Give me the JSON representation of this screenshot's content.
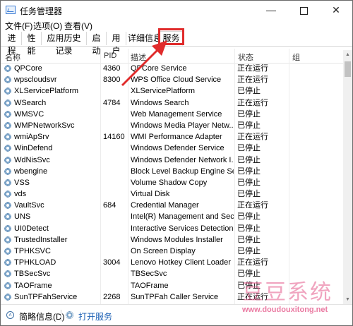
{
  "window": {
    "title": "任务管理器",
    "min_glyph": "—",
    "close_glyph": "✕"
  },
  "menu": [
    "文件(F)",
    "选项(O)",
    "查看(V)"
  ],
  "tabs": [
    "进程",
    "性能",
    "应用历史记录",
    "启动",
    "用户",
    "详细信息",
    "服务"
  ],
  "active_tab": "服务",
  "columns": {
    "name": "名称",
    "pid": "PID",
    "desc": "描述",
    "status": "状态",
    "group": "组"
  },
  "rows": [
    {
      "name": "QPCore",
      "pid": "4360",
      "desc": "QPCore Service",
      "status": "正在运行"
    },
    {
      "name": "wpscloudsvr",
      "pid": "8300",
      "desc": "WPS Office Cloud Service",
      "status": "正在运行"
    },
    {
      "name": "XLServicePlatform",
      "pid": "",
      "desc": "XLServicePlatform",
      "status": "已停止"
    },
    {
      "name": "WSearch",
      "pid": "4784",
      "desc": "Windows Search",
      "status": "正在运行"
    },
    {
      "name": "WMSVC",
      "pid": "",
      "desc": "Web Management Service",
      "status": "已停止"
    },
    {
      "name": "WMPNetworkSvc",
      "pid": "",
      "desc": "Windows Media Player Netw...",
      "status": "已停止"
    },
    {
      "name": "wmiApSrv",
      "pid": "14160",
      "desc": "WMI Performance Adapter",
      "status": "正在运行"
    },
    {
      "name": "WinDefend",
      "pid": "",
      "desc": "Windows Defender Service",
      "status": "已停止"
    },
    {
      "name": "WdNisSvc",
      "pid": "",
      "desc": "Windows Defender Network I...",
      "status": "已停止"
    },
    {
      "name": "wbengine",
      "pid": "",
      "desc": "Block Level Backup Engine Se...",
      "status": "已停止"
    },
    {
      "name": "VSS",
      "pid": "",
      "desc": "Volume Shadow Copy",
      "status": "已停止"
    },
    {
      "name": "vds",
      "pid": "",
      "desc": "Virtual Disk",
      "status": "已停止"
    },
    {
      "name": "VaultSvc",
      "pid": "684",
      "desc": "Credential Manager",
      "status": "正在运行"
    },
    {
      "name": "UNS",
      "pid": "",
      "desc": "Intel(R) Management and Sec...",
      "status": "已停止"
    },
    {
      "name": "UI0Detect",
      "pid": "",
      "desc": "Interactive Services Detection",
      "status": "已停止"
    },
    {
      "name": "TrustedInstaller",
      "pid": "",
      "desc": "Windows Modules Installer",
      "status": "已停止"
    },
    {
      "name": "TPHKSVC",
      "pid": "",
      "desc": "On Screen Display",
      "status": "已停止"
    },
    {
      "name": "TPHKLOAD",
      "pid": "3004",
      "desc": "Lenovo Hotkey Client Loader",
      "status": "正在运行"
    },
    {
      "name": "TBSecSvc",
      "pid": "",
      "desc": "TBSecSvc",
      "status": "已停止"
    },
    {
      "name": "TAOFrame",
      "pid": "",
      "desc": "TAOFrame",
      "status": "已停止"
    },
    {
      "name": "SunTPFahService",
      "pid": "2268",
      "desc": "SunTPFah Caller Service",
      "status": "正在运行"
    }
  ],
  "footer": {
    "fewer_details": "简略信息(D)",
    "open_services": "打开服务"
  },
  "watermark": {
    "title": "豆豆系统",
    "url": "www.doudouxitong.net"
  },
  "colors": {
    "annotation_red": "#e02b2b",
    "link_blue": "#1a5fb4",
    "watermark_pink": "#e55a8b"
  }
}
